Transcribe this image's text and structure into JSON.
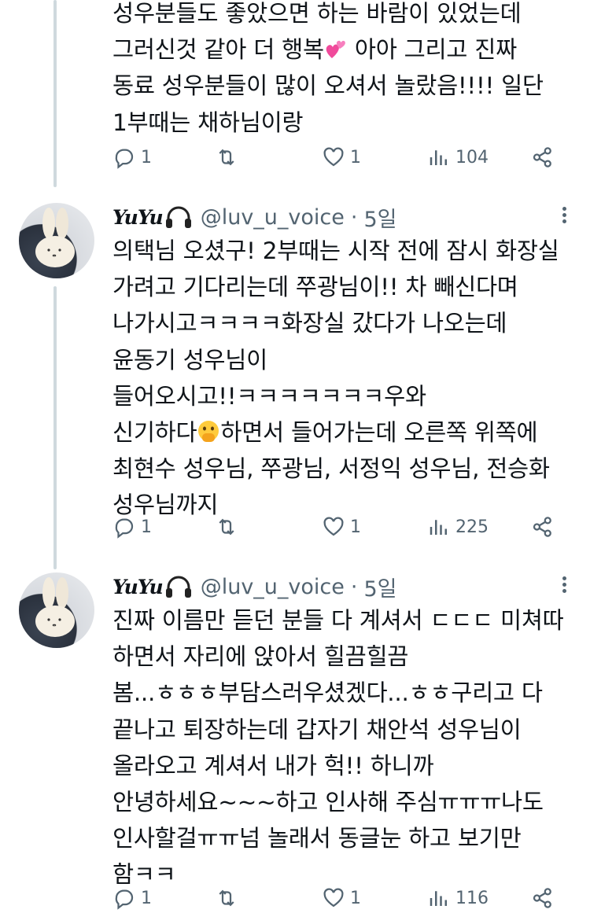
{
  "tweets": [
    {
      "text": "성우분들도 좋았으면 하는 바람이 있었는데\n그러신것 같아 더 행복{heart} 아아 그리고 진짜\n동료 성우분들이 많이 오셔서 놀랐음!!!! 일단\n1부때는 채하님이랑",
      "segments_before": "성우분들도 좋았으면 하는 바람이 있었는데\n그러신것 같아 더 행복",
      "segments_after": " 아아 그리고 진짜\n동료 성우분들이 많이 오셔서 놀랐음!!!! 일단\n1부때는 채하님이랑",
      "replies": "1",
      "retweets": "",
      "likes": "1",
      "views": "104"
    },
    {
      "display_name": "YuYu",
      "handle": "@luv_u_voice",
      "time": "5일",
      "segments_before": "의택님 오셨구! 2부때는 시작 전에 잠시 화장실\n가려고 기다리는데 쭈광님이!! 차 빼신다며\n나가시고ㅋㅋㅋㅋ화장실 갔다가 나오는데\n윤동기 성우님이\n들어오시고!!ㅋㅋㅋㅋㅋㅋㅋ우와\n신기하다",
      "segments_after": "하면서 들어가는데 오른쪽 위쪽에\n최현수 성우님, 쭈광님, 서정익 성우님, 전승화\n성우님까지",
      "replies": "1",
      "retweets": "",
      "likes": "1",
      "views": "225"
    },
    {
      "display_name": "YuYu",
      "handle": "@luv_u_voice",
      "time": "5일",
      "text": "진짜 이름만 듣던 분들 다 계셔서 ㄷㄷㄷ 미쳐따\n하면서 자리에 앉아서 힐끔힐끔\n봄...ㅎㅎㅎ부담스러우셨겠다...ㅎㅎ구리고 다\n끝나고 퇴장하는데 갑자기 채안석 성우님이\n올라오고 계셔서 내가 헉!! 하니까\n안녕하세요~~~하고 인사해 주심ㅠㅠㅠ나도\n인사할걸ㅠㅠ넘 놀래서 동글눈 하고 보기만\n함ㅋㅋ",
      "replies": "1",
      "retweets": "",
      "likes": "1",
      "views": "116"
    }
  ],
  "icons": {
    "reply": "reply-icon",
    "retweet": "retweet-icon",
    "like": "heart-icon",
    "views": "views-icon",
    "share": "share-icon",
    "more": "more-icon",
    "heart_emoji": "two-hearts-emoji",
    "face_emoji": "face-with-hand-over-mouth-emoji",
    "headphones": "headphones-emoji"
  },
  "colors": {
    "text": "#0f1419",
    "secondary": "#536471",
    "thread_line": "#cfd9de"
  }
}
